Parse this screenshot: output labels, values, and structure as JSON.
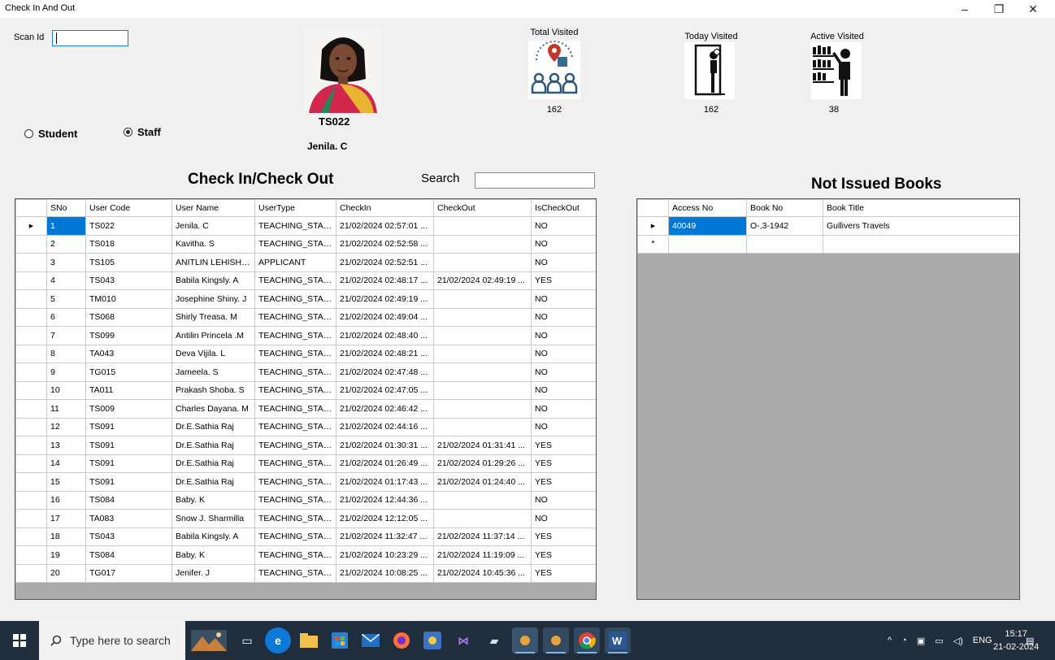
{
  "window": {
    "title": "Check In And Out",
    "min": "–",
    "max": "❐",
    "close": "✕"
  },
  "scan": {
    "label": "Scan Id",
    "value": ""
  },
  "user": {
    "code": "TS022",
    "name": "Jenila. C"
  },
  "radios": {
    "student_label": "Student",
    "staff_label": "Staff",
    "selected": "Staff"
  },
  "stats": {
    "total": {
      "title": "Total Visited",
      "value": "162"
    },
    "today": {
      "title": "Today Visited",
      "value": "162"
    },
    "active": {
      "title": "Active Visited",
      "value": "38"
    }
  },
  "checkin": {
    "title": "Check In/Check Out",
    "search_label": "Search",
    "search_value": "",
    "columns": [
      "SNo",
      "User Code",
      "User Name",
      "UserType",
      "CheckIn",
      "CheckOut",
      "IsCheckOut"
    ],
    "rows": [
      [
        "1",
        "TS022",
        "Jenila. C",
        "TEACHING_STAFF",
        "21/02/2024 02:57:01 ...",
        "",
        "NO"
      ],
      [
        "2",
        "TS018",
        "Kavitha. S",
        "TEACHING_STAFF",
        "21/02/2024 02:52:58 ...",
        "",
        "NO"
      ],
      [
        "3",
        "TS105",
        "ANITLIN LEHISHA X",
        "APPLICANT",
        "21/02/2024 02:52:51 ...",
        "",
        "NO"
      ],
      [
        "4",
        "TS043",
        "Babila Kingsly. A",
        "TEACHING_STAFF",
        "21/02/2024 02:48:17 ...",
        "21/02/2024 02:49:19 ...",
        "YES"
      ],
      [
        "5",
        "TM010",
        "Josephine Shiny. J",
        "TEACHING_STAFF",
        "21/02/2024 02:49:19 ...",
        "",
        "NO"
      ],
      [
        "6",
        "TS068",
        "Shirly Treasa. M",
        "TEACHING_STAFF",
        "21/02/2024 02:49:04 ...",
        "",
        "NO"
      ],
      [
        "7",
        "TS099",
        "Antilin Princela .M",
        "TEACHING_STAFF",
        "21/02/2024 02:48:40 ...",
        "",
        "NO"
      ],
      [
        "8",
        "TA043",
        "Deva Vijila. L",
        "TEACHING_STAFF",
        "21/02/2024 02:48:21 ...",
        "",
        "NO"
      ],
      [
        "9",
        "TG015",
        "Jameela. S",
        "TEACHING_STAFF",
        "21/02/2024 02:47:48 ...",
        "",
        "NO"
      ],
      [
        "10",
        "TA011",
        "Prakash Shoba. S",
        "TEACHING_STAFF",
        "21/02/2024 02:47:05 ...",
        "",
        "NO"
      ],
      [
        "11",
        "TS009",
        "Charles Dayana. M",
        "TEACHING_STAFF",
        "21/02/2024 02:46:42 ...",
        "",
        "NO"
      ],
      [
        "12",
        "TS091",
        "Dr.E.Sathia Raj",
        "TEACHING_STAFF",
        "21/02/2024 02:44:16 ...",
        "",
        "NO"
      ],
      [
        "13",
        "TS091",
        "Dr.E.Sathia Raj",
        "TEACHING_STAFF",
        "21/02/2024 01:30:31 ...",
        "21/02/2024 01:31:41 ...",
        "YES"
      ],
      [
        "14",
        "TS091",
        "Dr.E.Sathia Raj",
        "TEACHING_STAFF",
        "21/02/2024 01:26:49 ...",
        "21/02/2024 01:29:26 ...",
        "YES"
      ],
      [
        "15",
        "TS091",
        "Dr.E.Sathia Raj",
        "TEACHING_STAFF",
        "21/02/2024 01:17:43 ...",
        "21/02/2024 01:24:40 ...",
        "YES"
      ],
      [
        "16",
        "TS084",
        "Baby. K",
        "TEACHING_STAFF",
        "21/02/2024 12:44:36 ...",
        "",
        "NO"
      ],
      [
        "17",
        "TA083",
        "Snow J. Sharmilla",
        "TEACHING_STAFF",
        "21/02/2024 12:12:05 ...",
        "",
        "NO"
      ],
      [
        "18",
        "TS043",
        "Babila Kingsly. A",
        "TEACHING_STAFF",
        "21/02/2024 11:32:47 ...",
        "21/02/2024 11:37:14 ...",
        "YES"
      ],
      [
        "19",
        "TS084",
        "Baby. K",
        "TEACHING_STAFF",
        "21/02/2024 10:23:29 ...",
        "21/02/2024 11:19:09 ...",
        "YES"
      ],
      [
        "20",
        "TG017",
        "Jenifer. J",
        "TEACHING_STAFF",
        "21/02/2024 10:08:25 ...",
        "21/02/2024 10:45:36 ...",
        "YES"
      ]
    ]
  },
  "books": {
    "title": "Not Issued Books",
    "columns": [
      "Access No",
      "Book No",
      "Book Title"
    ],
    "rows": [
      [
        "40049",
        "O-,3-1942",
        "Gullivers Travels"
      ]
    ]
  },
  "taskbar": {
    "search_placeholder": "Type here to search",
    "lang": "ENG",
    "time": "15:17",
    "date": "21-02-2024"
  },
  "colors": {
    "selection": "#0078d7",
    "grid_background": "#ababab",
    "taskbar": "#1f2d3d"
  }
}
